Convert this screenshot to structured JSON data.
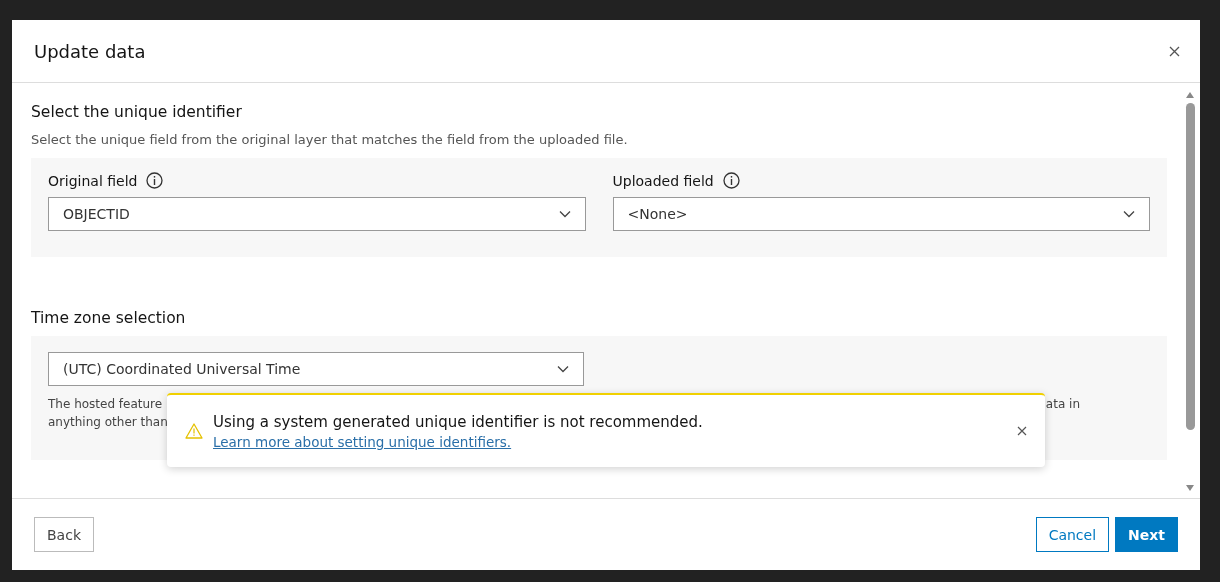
{
  "dialog": {
    "title": "Update data"
  },
  "identifier": {
    "title": "Select the unique identifier",
    "description": "Select the unique field from the original layer that matches the field from the uploaded file.",
    "fields": [
      {
        "label": "Original field",
        "value": "OBJECTID"
      },
      {
        "label": "Uploaded field",
        "value": "<None>"
      }
    ]
  },
  "timezone": {
    "title": "Time zone selection",
    "value": "(UTC) Coordinated Universal Time",
    "help_line_1_start": "The hosted feature",
    "help_line_1_end": "ata in",
    "help_line_2": "anything other than"
  },
  "alert": {
    "message": "Using a system generated unique identifier is not recommended.",
    "link": "Learn more about setting unique identifiers."
  },
  "footer": {
    "back": "Back",
    "cancel": "Cancel",
    "next": "Next"
  }
}
